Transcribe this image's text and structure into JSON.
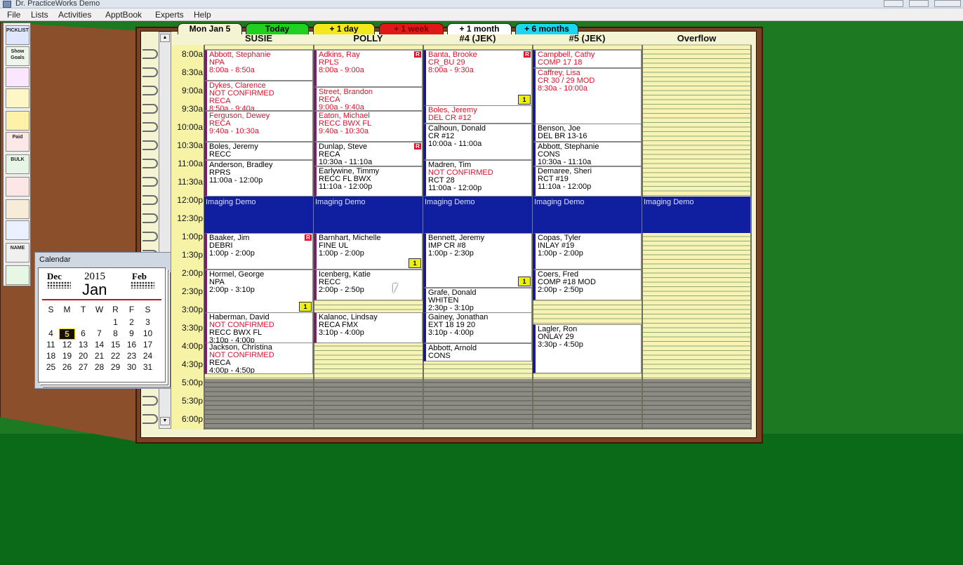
{
  "window": {
    "title": "Dr. PracticeWorks Demo"
  },
  "menu": [
    "File",
    "Lists",
    "Activities",
    "ApptBook",
    "Experts",
    "Help"
  ],
  "toolbar": [
    {
      "label": "PICKLIST",
      "icon": "picklist-icon"
    },
    {
      "label": "Show Goals",
      "icon": "goals-icon"
    },
    {
      "label": "",
      "icon": "color-grid-icon"
    },
    {
      "label": "",
      "icon": "bar-chart-icon"
    },
    {
      "label": "",
      "icon": "phone-icon"
    },
    {
      "label": "Paid",
      "icon": "paid-envelope-icon"
    },
    {
      "label": "BULK",
      "icon": "bulk-mail-icon"
    },
    {
      "label": "",
      "icon": "books-icon"
    },
    {
      "label": "",
      "icon": "books-alt-icon"
    },
    {
      "label": "",
      "icon": "handheld-icon"
    },
    {
      "label": "NAME",
      "icon": "name-card-icon"
    },
    {
      "label": "",
      "icon": "list-sheet-icon"
    }
  ],
  "nav": {
    "date": "Mon Jan 5",
    "today": "Today",
    "plus_day": "+ 1 day",
    "plus_week": "+ 1 week",
    "plus_month": "+ 1 month",
    "plus_6months": "+ 6 months",
    "colors": {
      "today": "#1fd01f",
      "day": "#f2e81c",
      "week": "#e01818",
      "month": "#ffffff",
      "six": "#1ad6f0"
    }
  },
  "columns": [
    "SUSIE",
    "POLLY",
    "#4 (JEK)",
    "#5 (JEK)",
    "Overflow"
  ],
  "times": [
    "8:00a",
    "8:30a",
    "9:00a",
    "9:30a",
    "10:00a",
    "10:30a",
    "11:00a",
    "11:30a",
    "12:00p",
    "12:30p",
    "1:00p",
    "1:30p",
    "2:00p",
    "2:30p",
    "3:00p",
    "3:30p",
    "4:00p",
    "4:30p",
    "5:00p",
    "5:30p",
    "6:00p"
  ],
  "blocks": [
    {
      "label": "Imaging Demo"
    },
    {
      "label": "Imaging Demo"
    },
    {
      "label": "Imaging Demo"
    },
    {
      "label": "Imaging Demo"
    },
    {
      "label": "Imaging Demo"
    }
  ],
  "appointments": [
    {
      "name": "Abbott, Stephanie",
      "line2": "NPA",
      "line3": "8:00a - 8:50a",
      "red": [
        0,
        1,
        2
      ]
    },
    {
      "name": "Dykes, Clarence",
      "line2": "NOT CONFIRMED",
      "line3": "RECA",
      "line4": "8:50a - 9:40a",
      "red": [
        0,
        1,
        2,
        3
      ]
    },
    {
      "name": "Ferguson, Dewey",
      "line2": "RECA",
      "line3": "9:40a - 10:30a",
      "red": [
        0,
        1,
        2
      ]
    },
    {
      "name": "Boles, Jeremy",
      "line2": "RECC",
      "red": []
    },
    {
      "name": "Anderson, Bradley",
      "line2": "RPRS",
      "line3": "11:00a - 12:00p",
      "red": []
    },
    {
      "name": "Baaker, Jim",
      "line2": "DEBRI",
      "line3": "1:00p - 2:00p",
      "red": [],
      "badge": "R"
    },
    {
      "name": "Hormel, George",
      "line2": "NPA",
      "line3": "2:00p - 3:10p",
      "red": [],
      "note": "1"
    },
    {
      "name": "Haberman, David",
      "line2": "NOT CONFIRMED",
      "line3": "RECC BWX FL",
      "line4": "3:10p - 4:00p",
      "red": [
        1
      ]
    },
    {
      "name": "Jackson, Christina",
      "line2": "NOT CONFIRMED",
      "line3": "RECA",
      "line4": "4:00p - 4:50p",
      "red": [
        1
      ]
    },
    {
      "name": "Adkins, Ray",
      "line2": "RPLS",
      "line3": "8:00a - 9:00a",
      "red": [
        0,
        1,
        2
      ],
      "badge": "R"
    },
    {
      "name": "Street, Brandon",
      "line2": "RECA",
      "line3": "9:00a - 9:40a",
      "red": [
        0,
        1,
        2
      ]
    },
    {
      "name": "Eaton, Michael",
      "line2": "RECC BWX FL",
      "line3": "9:40a - 10:30a",
      "red": [
        0,
        1,
        2
      ]
    },
    {
      "name": "Dunlap, Steve",
      "line2": "RECA",
      "line3": "10:30a - 11:10a",
      "red": [],
      "badge": "R"
    },
    {
      "name": "Earlywine, Timmy",
      "line2": "RECC FL BWX",
      "line3": "11:10a - 12:00p",
      "red": []
    },
    {
      "name": "Barnhart, Michelle",
      "line2": "FINE UL",
      "line3": "1:00p - 2:00p",
      "red": [],
      "note": "1"
    },
    {
      "name": "Icenberg, Katie",
      "line2": "RECC",
      "line3": "2:00p - 2:50p",
      "red": []
    },
    {
      "name": "Kalanoc, Lindsay",
      "line2": "RECA FMX",
      "line3": "3:10p - 4:00p",
      "red": []
    },
    {
      "name": "Banta, Brooke",
      "line2": "CR_BU 29",
      "line3": "8:00a - 9:30a",
      "red": [
        0,
        1,
        2
      ],
      "badge": "R",
      "note": "1"
    },
    {
      "name": "Boles, Jeremy",
      "line2": "DEL CR #12",
      "red": [
        0,
        1
      ]
    },
    {
      "name": "Calhoun, Donald",
      "line2": "CR #12",
      "line3": "10:00a - 11:00a",
      "red": []
    },
    {
      "name": "Madren, Tim",
      "line2": "NOT CONFIRMED",
      "line3": "RCT 28",
      "line4": "11:00a - 12:00p",
      "red": [
        1
      ]
    },
    {
      "name": "Bennett, Jeremy",
      "line2": "IMP CR #8",
      "line3": "1:00p - 2:30p",
      "red": [],
      "note": "1"
    },
    {
      "name": "Grafe, Donald",
      "line2": "WHITEN",
      "line3": "2:30p - 3:10p",
      "red": []
    },
    {
      "name": "Gainey, Jonathan",
      "line2": "EXT 18 19 20",
      "line3": "3:10p - 4:00p",
      "red": []
    },
    {
      "name": "Abbott, Arnold",
      "line2": "CONS",
      "red": []
    },
    {
      "name": "Campbell, Cathy",
      "line2": "COMP 17 18",
      "red": [
        0,
        1
      ]
    },
    {
      "name": "Caffrey, Lisa",
      "line2": "CR 30 / 29 MOD",
      "line3": "8:30a - 10:00a",
      "red": [
        0,
        1,
        2
      ]
    },
    {
      "name": "Benson, Joe",
      "line2": "DEL BR 13-16",
      "red": []
    },
    {
      "name": "Abbott, Stephanie",
      "line2": "CONS",
      "line3": "10:30a - 11:10a",
      "red": []
    },
    {
      "name": "Demaree, Sheri",
      "line2": "RCT #19",
      "line3": "11:10a - 12:00p",
      "red": []
    },
    {
      "name": "Copas, Tyler",
      "line2": "INLAY #19",
      "line3": "1:00p - 2:00p",
      "red": []
    },
    {
      "name": "Coers, Fred",
      "line2": "COMP #18 MOD",
      "line3": "2:00p - 2:50p",
      "red": []
    },
    {
      "name": "Lagler, Ron",
      "line2": "ONLAY 29",
      "line3": "3:30p - 4:50p",
      "red": []
    }
  ],
  "calendar": {
    "title": "Calendar",
    "prev": "Dec",
    "next": "Feb",
    "year": "2015",
    "month": "Jan",
    "dow": [
      "S",
      "M",
      "T",
      "W",
      "R",
      "F",
      "S"
    ],
    "weeks": [
      [
        "",
        "",
        "",
        "",
        "1",
        "2",
        "3"
      ],
      [
        "4",
        "5",
        "6",
        "7",
        "8",
        "9",
        "10"
      ],
      [
        "11",
        "12",
        "13",
        "14",
        "15",
        "16",
        "17"
      ],
      [
        "18",
        "19",
        "20",
        "21",
        "22",
        "23",
        "24"
      ],
      [
        "25",
        "26",
        "27",
        "28",
        "29",
        "30",
        "31"
      ]
    ],
    "selected": "5"
  }
}
